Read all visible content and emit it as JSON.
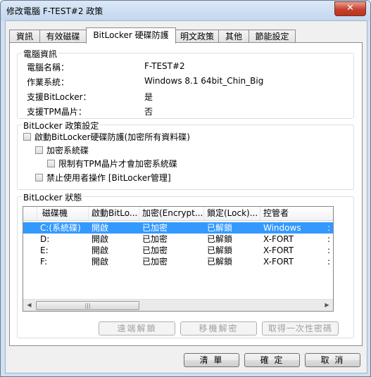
{
  "window": {
    "title": "修改電腦 F-TEST#2 政策",
    "close_label": "✕"
  },
  "tabs": [
    {
      "label": "資訊"
    },
    {
      "label": "有效磁碟"
    },
    {
      "label": "BitLocker 硬碟防護"
    },
    {
      "label": "明文政策"
    },
    {
      "label": "其他"
    },
    {
      "label": "節能設定"
    }
  ],
  "computer_info": {
    "group_title": "電腦資訊",
    "rows": [
      {
        "label": "電腦名稱：",
        "value": "F-TEST#2"
      },
      {
        "label": "作業系統：",
        "value": "Windows 8.1 64bit_Chin_Big"
      },
      {
        "label": "支援BitLocker：",
        "value": "是"
      },
      {
        "label": "支援TPM晶片：",
        "value": "否"
      }
    ]
  },
  "policy": {
    "group_title": "BitLocker 政策設定",
    "enable_label": "啟動BitLocker硬碟防護(加密所有資料碟)",
    "encrypt_system_label": "加密系統碟",
    "tpm_only_label": "限制有TPM晶片才會加密系統碟",
    "forbid_user_label": "禁止使用者操作 [BitLocker管理]"
  },
  "status": {
    "group_title": "BitLocker 狀態",
    "columns": [
      "磁碟機",
      "啟動BitLo...",
      "加密(Encrypt...",
      "鎖定(Lock)...",
      "控管者"
    ],
    "rows": [
      {
        "drive": "C:(系統碟)",
        "enabled": "開啟",
        "encrypt": "已加密",
        "lock": "已解鎖",
        "owner": "Windows",
        "more": ":"
      },
      {
        "drive": "D:",
        "enabled": "開啟",
        "encrypt": "已加密",
        "lock": "已解鎖",
        "owner": "X-FORT",
        "more": ":"
      },
      {
        "drive": "E:",
        "enabled": "開啟",
        "encrypt": "已加密",
        "lock": "已解鎖",
        "owner": "X-FORT",
        "more": ":"
      },
      {
        "drive": "F:",
        "enabled": "開啟",
        "encrypt": "已加密",
        "lock": "已解鎖",
        "owner": "X-FORT",
        "more": ":"
      }
    ],
    "scroll_left": "◀",
    "scroll_right": "▶",
    "scroll_thumb": "|||",
    "buttons": {
      "remote_unlock": "遠端解鎖",
      "remove_decrypt": "移機解密",
      "one_time_password": "取得一次性密碼"
    }
  },
  "footer": {
    "clear": "清 單",
    "ok": "確 定",
    "cancel": "取 消"
  },
  "colors": {
    "selection": "#3399ff",
    "close": "#c6402c",
    "frame": "#cfe0f2"
  }
}
